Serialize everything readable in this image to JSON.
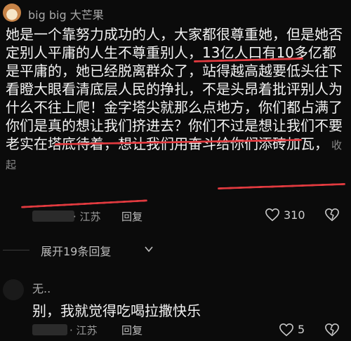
{
  "comment1": {
    "username": "big big 大芒果",
    "text": "她是一个靠努力成功的人，大家都很尊重她，但是她否定别人平庸的人生不尊重别人，13亿人口有10多亿都是平庸的，她已经脱离群众了，站得越高越要低头往下看瞪大眼看清底层人民的挣扎，不是头昂着批评别人为什么不往上爬！金字塔尖就那么点地方，你们都占满了你们是真的想让我们挤进去？你们不过是想让我们不要老实在塔底待着，想让我们用奋斗给你们添砖加瓦，",
    "collapse_label": "收起",
    "location": "· 江苏",
    "reply_label": "回复",
    "like_count": "310"
  },
  "expand_replies_label": "展开19条回复",
  "comment2": {
    "username": "无..",
    "text": "别，我就觉得吃喝拉撒快乐",
    "location": "· 江苏",
    "reply_label": "回复",
    "like_count": "5"
  },
  "highlight_color": "#e13a3f"
}
